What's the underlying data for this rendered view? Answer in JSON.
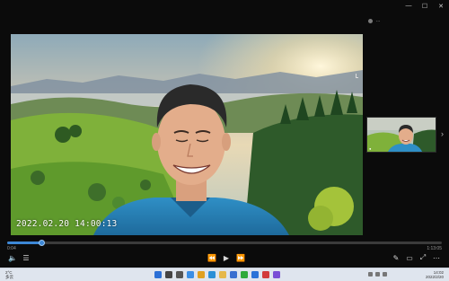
{
  "window": {
    "minimize_glyph": "—",
    "maximize_glyph": "☐",
    "close_glyph": "✕"
  },
  "participants": {
    "label": "..."
  },
  "video": {
    "overlay_timestamp": "2022.02.20  14:00:13",
    "thumbnail_badge": "●"
  },
  "player": {
    "current_time": "0:04",
    "total_time": "1:13:05",
    "progress_fraction": 0.08,
    "left_controls": [
      {
        "icon": "speaker-icon",
        "glyph": "🔈"
      },
      {
        "icon": "playlist-icon",
        "glyph": "☰"
      }
    ],
    "center_controls": [
      {
        "icon": "rewind-icon",
        "glyph": "⏪"
      },
      {
        "icon": "play-icon",
        "glyph": "▶"
      },
      {
        "icon": "forward-icon",
        "glyph": "⏩"
      }
    ],
    "right_controls": [
      {
        "icon": "pen-icon",
        "glyph": "✎"
      },
      {
        "icon": "caption-icon",
        "glyph": "▭"
      },
      {
        "icon": "fullscreen-icon",
        "glyph": "⤢"
      },
      {
        "icon": "more-icon",
        "glyph": "⋯"
      }
    ]
  },
  "taskbar": {
    "weather_line1": "2°C",
    "weather_line2": "多云",
    "clock_line1": "14:02",
    "clock_line2": "2022/2/20",
    "pinned_apps": [
      "start-icon",
      "search-icon",
      "task-view-icon",
      "widgets-icon",
      "chrome-icon",
      "edge-icon",
      "explorer-icon",
      "store-icon",
      "wechat-icon",
      "mail-icon",
      "video-app-icon",
      "photos-icon"
    ]
  },
  "colors": {
    "accent": "#3d87d6",
    "taskbar_bg": "#dfe5ee",
    "app_bg": "#0b0b0b"
  }
}
